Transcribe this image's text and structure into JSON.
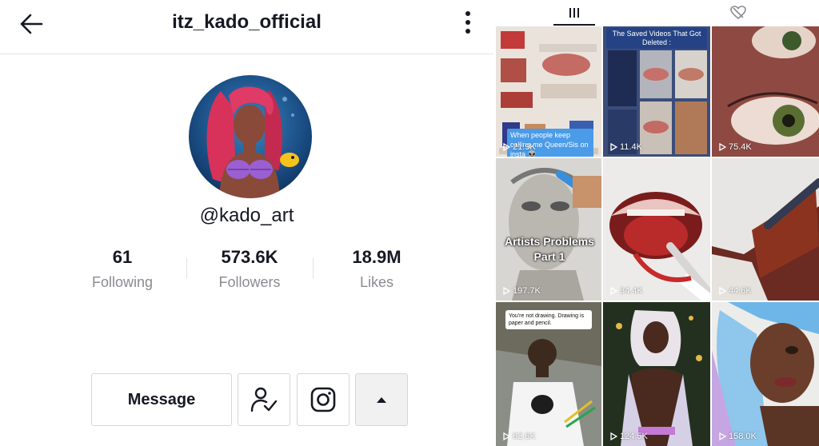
{
  "header": {
    "title": "itz_kado_official",
    "back_icon": "arrow-left-icon",
    "more_icon": "vertical-dots-icon"
  },
  "profile": {
    "handle": "@kado_art",
    "stats": [
      {
        "value": "61",
        "label": "Following"
      },
      {
        "value": "573.6K",
        "label": "Followers"
      },
      {
        "value": "18.9M",
        "label": "Likes"
      }
    ]
  },
  "actions": {
    "message_label": "Message",
    "follow_icon": "user-check-icon",
    "instagram_icon": "instagram-icon",
    "expand_icon": "caret-up-icon"
  },
  "tabs": {
    "videos_icon": "grid-bars-icon",
    "liked_icon": "hidden-heart-icon"
  },
  "videos": [
    {
      "views": "21.9K",
      "caption": "When people keep calling me Queen/Sis on insta 👽"
    },
    {
      "views": "11.4K",
      "caption": "The Saved Videos That Got Deleted :"
    },
    {
      "views": "75.4K"
    },
    {
      "views": "197.7K",
      "caption": "Artists Problems Part 1"
    },
    {
      "views": "34.4K"
    },
    {
      "views": "44.6K"
    },
    {
      "views": "62.6K",
      "caption": "You're not drawing. Drawing is paper and pencil."
    },
    {
      "views": "124.5K"
    },
    {
      "views": "158.0K"
    }
  ],
  "colors": {
    "text_primary": "#161823",
    "text_secondary": "#8a8b91",
    "border": "#e3e3e3"
  }
}
